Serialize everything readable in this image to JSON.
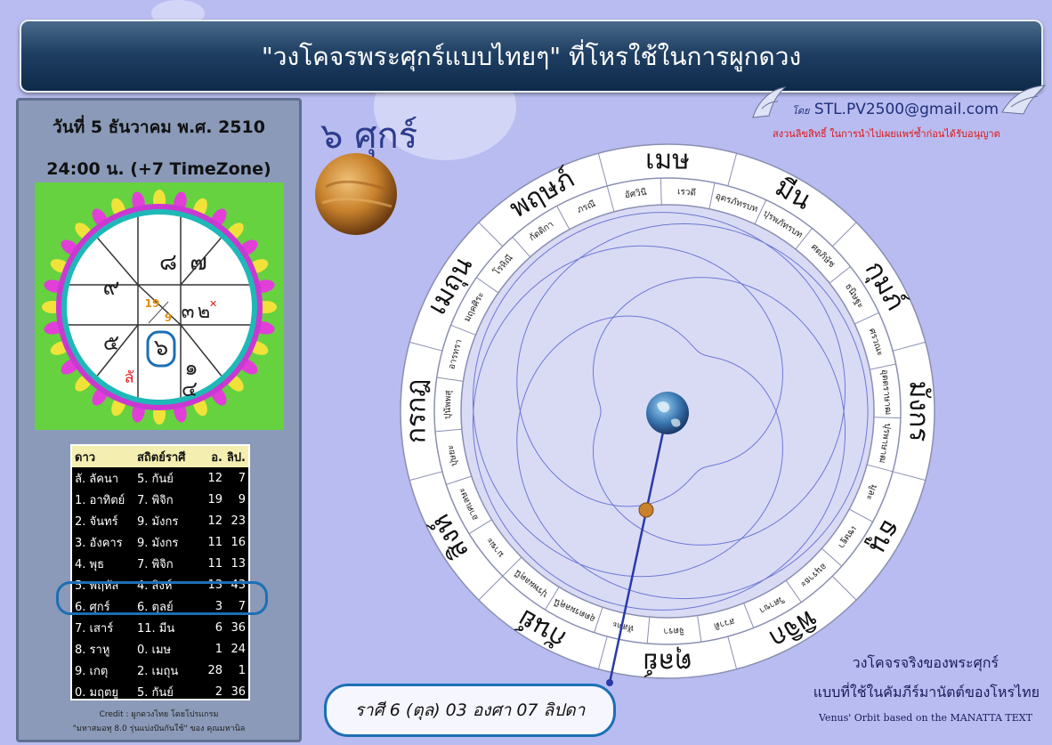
{
  "title": "\"วงโคจรพระศุกร์แบบไทยๆ\" ที่โหรใช้ในการผูกดวง",
  "author_prefix": "โดย",
  "email": "STL.PV2500@gmail.com",
  "copyright": "สงวนลิขสิทธิ์ ในการนำไปเผยแพร่ซ้ำก่อนได้รับอนุญาต",
  "date_line": "วันที่ 5 ธันวาคม พ.ศ. 2510",
  "time_line": "24:00 น. (+7 TimeZone)",
  "venus_label": "๖ ศุกร์",
  "chart": {
    "houses": [
      "๘",
      "๗",
      "๙",
      "๓",
      "๕",
      "๖",
      "๑",
      "๔",
      "๒"
    ],
    "lagna_mark": "ลั",
    "degree_top": "19",
    "degree_bottom": "9"
  },
  "table": {
    "headers": [
      "ดาว",
      "สถิตย์ราศี",
      "อ.",
      "ลิป."
    ],
    "rows": [
      [
        "ลั. ลัคนา",
        "5. กันย์",
        "12",
        "7"
      ],
      [
        "1. อาทิตย์",
        "7. พิจิก",
        "19",
        "9"
      ],
      [
        "2. จันทร์",
        "9. มังกร",
        "12",
        "23"
      ],
      [
        "3. อังคาร",
        "9. มังกร",
        "11",
        "16"
      ],
      [
        "4. พุธ",
        "7. พิจิก",
        "11",
        "13"
      ],
      [
        "5. พฤหัส",
        "4. สิงห์",
        "13",
        "43"
      ],
      [
        "6. ศุกร์",
        "6. ตุลย์",
        "3",
        "7"
      ],
      [
        "7. เสาร์",
        "11. มีน",
        "6",
        "36"
      ],
      [
        "8. ราหู",
        "0. เมษ",
        "1",
        "24"
      ],
      [
        "9. เกตุ",
        "2. เมถุน",
        "28",
        "1"
      ],
      [
        "0. มฤตยู",
        "5. กันย์",
        "2",
        "36"
      ]
    ]
  },
  "credit_line1": "Credit : ผูกดวงไทย โดยโปรแกรม",
  "credit_line2": "\"มหาสมอทุ 8.0 รุ่นแบ่งปันกันใช้\" ของ คุณมหานิล",
  "zodiac": [
    "เมษ",
    "มีน",
    "กุมภ์",
    "มังกร",
    "ธนู",
    "พิจิก",
    "ตุลย์",
    "กันย์",
    "สิงห์",
    "กรกฎ",
    "เมถุน",
    "พฤษภ์"
  ],
  "nakshatra": [
    "อัศวินี",
    "ภรณี",
    "กัตติกา",
    "โรหิณี",
    "มฤคศิระ",
    "อารทรา",
    "ปุนัพพสุ",
    "ปุษยะ",
    "อาศเลษะ",
    "มาฆะ",
    "ปุรพผลคุนี",
    "อุตตรผลคุนี",
    "หัสตะ",
    "จิตรา",
    "สวาติ",
    "วิศาขา",
    "อนุราธะ",
    "เชษฐา",
    "มูละ",
    "ปุรพาษาฒ",
    "อุตตราษาฒ",
    "ศรวณะ",
    "ธนิษฐะ",
    "ศตภิษัช",
    "ปุรพภัทรบท",
    "อุตรภัทรบท",
    "เรวดี"
  ],
  "bottom_text": "ราศี 6 (ตุล) 03 องศา 07 ลิปดา",
  "caption_line1": "วงโคจรจริงของพระศุกร์",
  "caption_line2": "แบบที่ใช้ในคัมภีร์มานัตต์ของโหรไทย",
  "caption_en": "Venus' Orbit based on the MANATTA TEXT",
  "colors": {
    "banner": "#1f3f63",
    "orbit": "#4a55c8",
    "highlight": "#1c6fb5",
    "venus": "#c8822c"
  }
}
